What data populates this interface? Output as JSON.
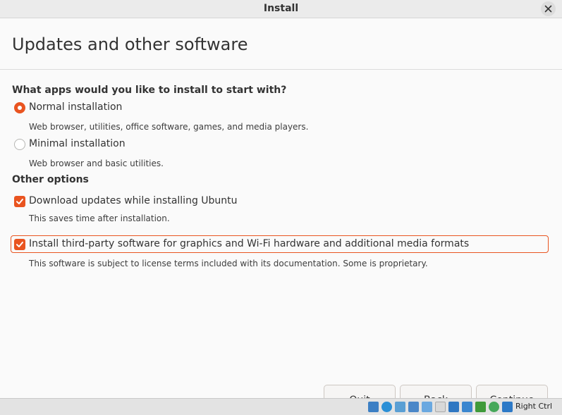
{
  "window": {
    "title": "Install",
    "close_icon": "close-icon"
  },
  "header": {
    "title": "Updates and other software"
  },
  "install_type": {
    "heading": "What apps would you like to install to start with?",
    "options": [
      {
        "label": "Normal installation",
        "description": "Web browser, utilities, office software, games, and media players.",
        "selected": true
      },
      {
        "label": "Minimal installation",
        "description": "Web browser and basic utilities.",
        "selected": false
      }
    ]
  },
  "other_options": {
    "heading": "Other options",
    "items": [
      {
        "label": "Download updates while installing Ubuntu",
        "description": "This saves time after installation.",
        "checked": true
      },
      {
        "label": "Install third-party software for graphics and Wi-Fi hardware and additional media formats",
        "description": "This software is subject to license terms included with its documentation. Some is proprietary.",
        "checked": true
      }
    ]
  },
  "buttons": {
    "quit": "Quit",
    "back": "Back",
    "continue": "Continue"
  },
  "statusbar": {
    "host_key": "Right Ctrl",
    "icons": [
      "hard-disk-icon",
      "optical-drive-icon",
      "audio-icon",
      "network-icon",
      "usb-icon",
      "shared-folder-icon",
      "display-icon",
      "screen-capture-icon",
      "recording-icon",
      "cpu-icon",
      "mouse-integration-icon",
      "keyboard-icon"
    ]
  },
  "colors": {
    "accent": "#e95420",
    "background": "#fafafa",
    "titlebar": "#ebebeb"
  }
}
